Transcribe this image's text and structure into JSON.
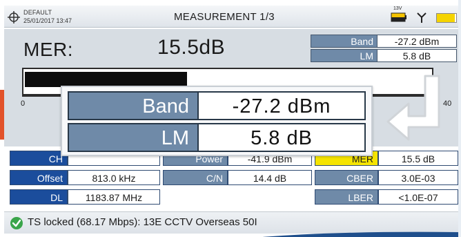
{
  "header": {
    "profile": "DEFAULT",
    "datetime": "25/01/2017 13:47",
    "title": "MEASUREMENT 1/3",
    "battery_label": "13V",
    "icons": [
      "crosshair-icon",
      "battery-icon",
      "antenna-tool-icon",
      "level-bar-icon"
    ]
  },
  "main": {
    "mer_label": "MER:",
    "mer_value": "15.5dB",
    "side_table": [
      {
        "key": "Band",
        "value": "-27.2 dBm"
      },
      {
        "key": "LM",
        "value": "5.8 dB"
      }
    ],
    "bar": {
      "level_fraction": 0.4,
      "scale_min": "0",
      "scale_max": "40"
    }
  },
  "zoom": [
    {
      "key": "Band",
      "value": "-27.2  dBm"
    },
    {
      "key": "LM",
      "value": "5.8  dB"
    }
  ],
  "grid": {
    "row1": {
      "k1": "CH",
      "v1": "",
      "k2": "Power",
      "v2": "-41.9 dBm",
      "k3": "MER",
      "v3": "15.5 dB"
    },
    "row2": {
      "k1": "Offset",
      "v1": "813.0 kHz",
      "k2": "C/N",
      "v2": "14.4 dB",
      "k3": "CBER",
      "v3": "3.0E-03"
    },
    "row3": {
      "k1": "DL",
      "v1": "1183.87 MHz",
      "k3": "LBER",
      "v3": "<1.0E-07"
    }
  },
  "status": {
    "text": "TS locked (68.17 Mbps): 13E CCTV  Overseas 50I",
    "icon": "check-circle-icon"
  },
  "colors": {
    "blue_key": "#1b4d9c",
    "steel_key": "#6f8aa8",
    "yellow_key": "#f5e400",
    "accent_orange": "#e2522a"
  }
}
